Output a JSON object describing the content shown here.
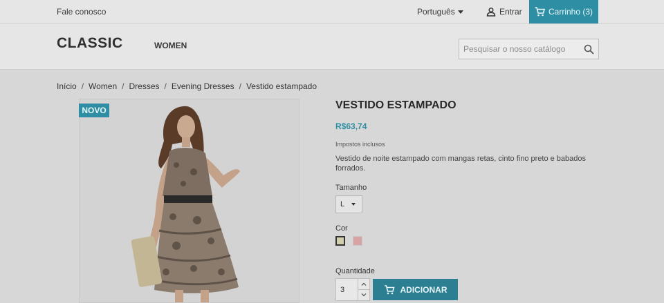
{
  "topnav": {
    "contact_label": "Fale conosco",
    "language": "Português",
    "signin_label": "Entrar",
    "cart_label": "Carrinho (3)"
  },
  "header": {
    "logo": "CLASSIC",
    "menu_women": "WOMEN",
    "search_placeholder": "Pesquisar o nosso catálogo"
  },
  "breadcrumb": [
    "Início",
    "Women",
    "Dresses",
    "Evening Dresses",
    "Vestido estampado"
  ],
  "product": {
    "badge": "NOVO",
    "title": "VESTIDO ESTAMPADO",
    "price": "R$63,74",
    "tax_note": "Impostos inclusos",
    "description": "Vestido de noite estampado com mangas retas, cinto fino preto e babados forrados.",
    "size_label": "Tamanho",
    "size_value": "L",
    "color_label": "Cor",
    "colors": [
      "#d1cfae",
      "#d8a3a3"
    ],
    "quantity_label": "Quantidade",
    "quantity_value": "3",
    "add_label": "ADICIONAR"
  },
  "colors": {
    "accent": "#2e8ea3",
    "overlay_bg": "#d7d7d7"
  }
}
